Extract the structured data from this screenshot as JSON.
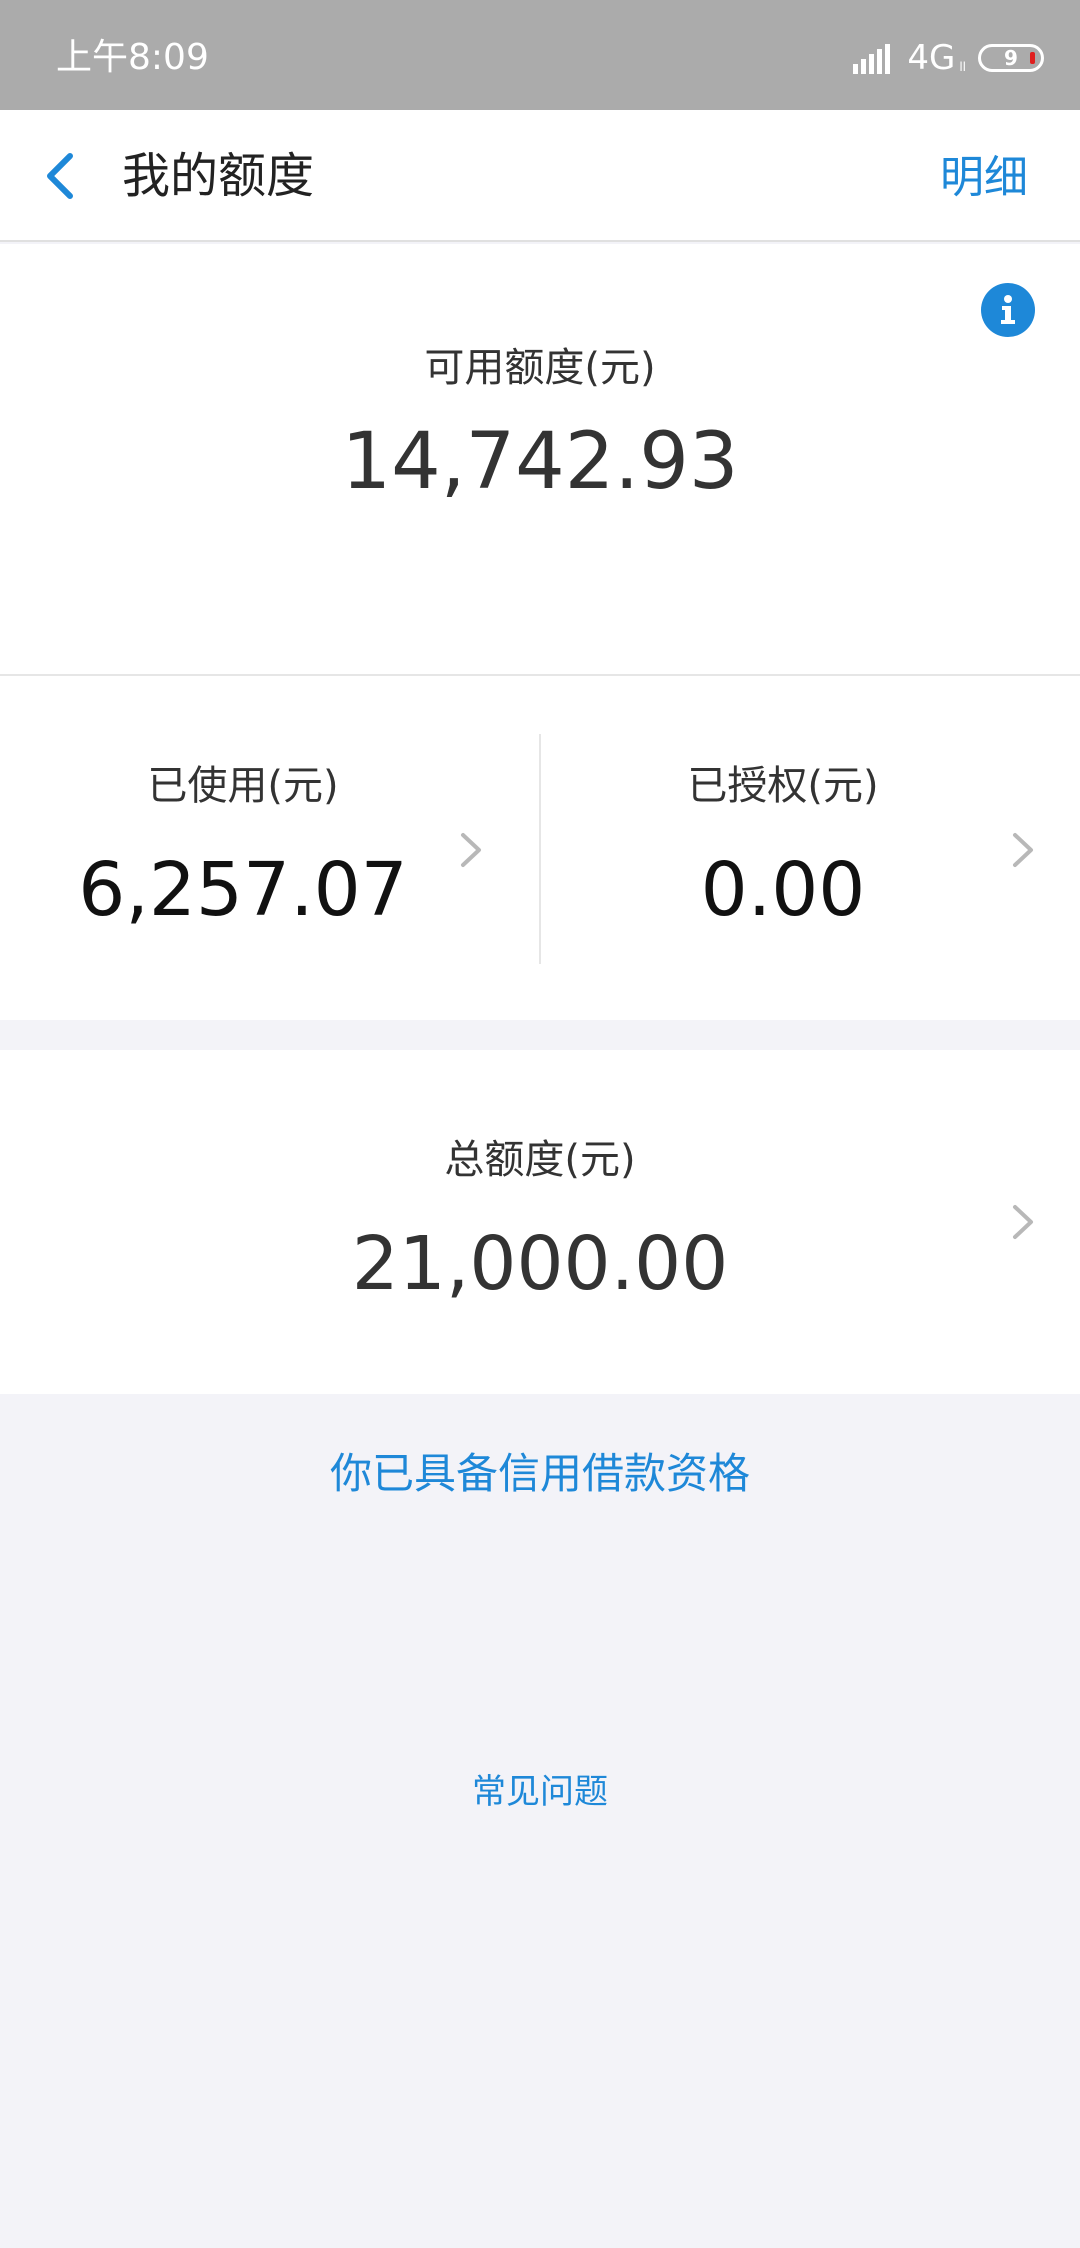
{
  "status_bar": {
    "time": "上午8:09",
    "network": "4G",
    "volte": "ll",
    "battery_level": "9"
  },
  "nav": {
    "title": "我的额度",
    "detail_label": "明细"
  },
  "available": {
    "label": "可用额度(元)",
    "value": "14,742.93"
  },
  "used": {
    "label": "已使用(元)",
    "value": "6,257.07"
  },
  "authorized": {
    "label": "已授权(元)",
    "value": "0.00"
  },
  "total": {
    "label": "总额度(元)",
    "value": "21,000.00"
  },
  "eligibility_text": "你已具备信用借款资格",
  "faq_label": "常见问题",
  "colors": {
    "accent": "#1e88d8",
    "status_bar": "#ababab",
    "background": "#f3f3f8"
  },
  "icons": {
    "back": "chevron-left-icon",
    "info": "info-icon",
    "row_arrow": "chevron-right-icon"
  }
}
